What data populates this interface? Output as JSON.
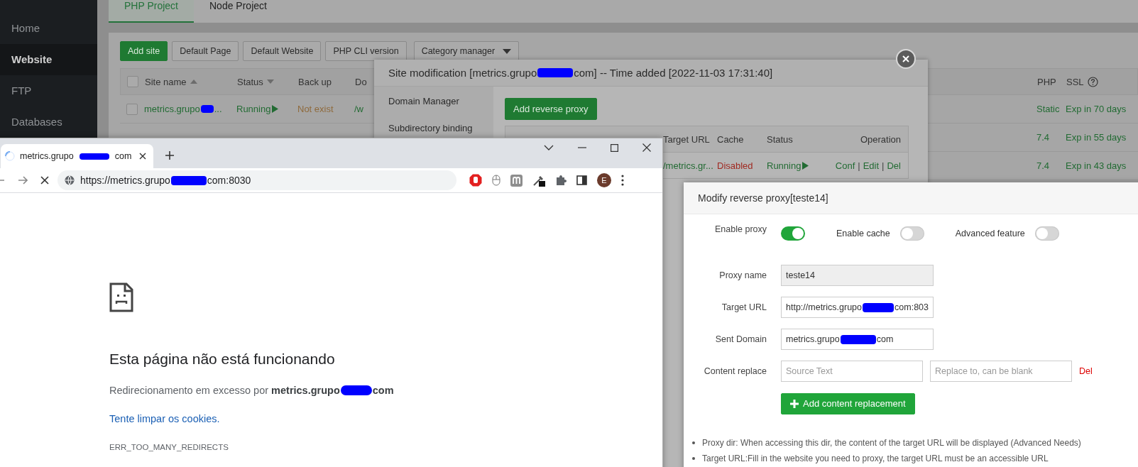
{
  "sidebar": {
    "items": [
      {
        "label": "Home",
        "selected": false
      },
      {
        "label": "Website",
        "selected": true
      },
      {
        "label": "FTP",
        "selected": false
      },
      {
        "label": "Databases",
        "selected": false
      }
    ]
  },
  "project_tabs": [
    {
      "label": "PHP Project",
      "selected": true
    },
    {
      "label": "Node Project",
      "selected": false
    }
  ],
  "toolbar": {
    "buttons": [
      {
        "label": "Add site",
        "kind": "primary"
      },
      {
        "label": "Default Page",
        "kind": "plain"
      },
      {
        "label": "Default Website",
        "kind": "plain"
      },
      {
        "label": "PHP CLI version",
        "kind": "plain"
      },
      {
        "label": "Category manager",
        "kind": "dropdown"
      }
    ]
  },
  "sites_table": {
    "select_all_checked": false,
    "columns": [
      "Site name",
      "Status",
      "Back up",
      "Do"
    ],
    "right_columns": [
      "PHP",
      "SSL"
    ],
    "rows": [
      {
        "checked": false,
        "site_name_parts": [
          "metrics.grupo",
          "..."
        ],
        "status": "Running",
        "backup": "Not exist",
        "path": "/w",
        "php": "Static",
        "ssl": "Exp in 70 days"
      },
      {
        "php": "7.4",
        "ssl": "Exp in 55 days"
      },
      {
        "php": "7.4",
        "ssl": "Exp in 43 days"
      }
    ]
  },
  "site_modal": {
    "title_parts": [
      "Site modification [metrics.grupo",
      "com] -- Time added [2022-11-03 17:31:40]"
    ],
    "nav": [
      "Domain Manager",
      "Subdirectory binding"
    ],
    "add_button": "Add reverse proxy",
    "proxy_table": {
      "columns": [
        "Target URL",
        "Cache",
        "Status",
        "Operation"
      ],
      "rows": [
        {
          "target_url": "/metrics.gr...",
          "cache": "Disabled",
          "cache_enabled": false,
          "status": "Running",
          "operations": [
            "Conf",
            "Edit",
            "Del"
          ],
          "operation_separator": "|"
        }
      ]
    }
  },
  "browser": {
    "tab": {
      "title_parts": [
        "metrics.grupo",
        "com"
      ],
      "loading": true
    },
    "address_parts": [
      "https://metrics.grupo",
      "com:8030"
    ],
    "avatar": "E",
    "error": {
      "heading": "Esta página não está funcionando",
      "message_parts": [
        "Redirecionamento em excesso por **metrics.grupo**",
        "com"
      ],
      "link": "Tente limpar os cookies.",
      "code": "ERR_TOO_MANY_REDIRECTS"
    }
  },
  "proxy_dialog": {
    "title": "Modify reverse proxy[teste14]",
    "toggles": [
      {
        "label": "Enable proxy",
        "on": true
      },
      {
        "label": "Enable cache",
        "on": false
      },
      {
        "label": "Advanced feature",
        "on": false
      }
    ],
    "fields": [
      {
        "label": "Proxy name",
        "value_parts": [
          "teste14"
        ],
        "disabled": true
      },
      {
        "label": "Target URL",
        "value_parts": [
          "http://metrics.grupo",
          "com:803"
        ],
        "disabled": false
      },
      {
        "label": "Sent Domain",
        "value_parts": [
          "metrics.grupo",
          "com"
        ],
        "disabled": false
      }
    ],
    "content_replace": {
      "label": "Content replace",
      "source_placeholder": "Source Text",
      "replace_placeholder": "Replace to, can be blank",
      "delete": "Del"
    },
    "add_button": "Add content replacement",
    "notes": [
      "Proxy dir: When accessing this dir, the content of the target URL will be displayed (Advanced Needs)",
      "Target URL:Fill in the website you need to proxy, the target URL must be an accessible URL"
    ]
  }
}
